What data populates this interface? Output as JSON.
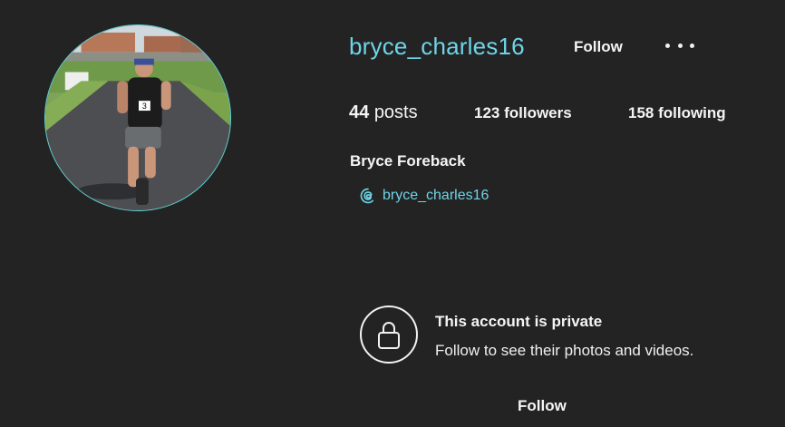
{
  "profile": {
    "username": "bryce_charles16",
    "follow_label": "Follow",
    "full_name": "Bryce Foreback",
    "threads_handle": "bryce_charles16",
    "race_bib": "3"
  },
  "stats": {
    "posts_count": "44",
    "posts_label": "posts",
    "followers": "123 followers",
    "following": "158 following"
  },
  "private_notice": {
    "title": "This account is private",
    "subtitle": "Follow to see their photos and videos.",
    "follow_label": "Follow"
  },
  "colors": {
    "background": "#232323",
    "accent": "#6fd4e8",
    "text": "#f5f5f5"
  },
  "icons": {
    "more": "more-options-icon",
    "threads": "threads-icon",
    "lock": "lock-icon"
  }
}
